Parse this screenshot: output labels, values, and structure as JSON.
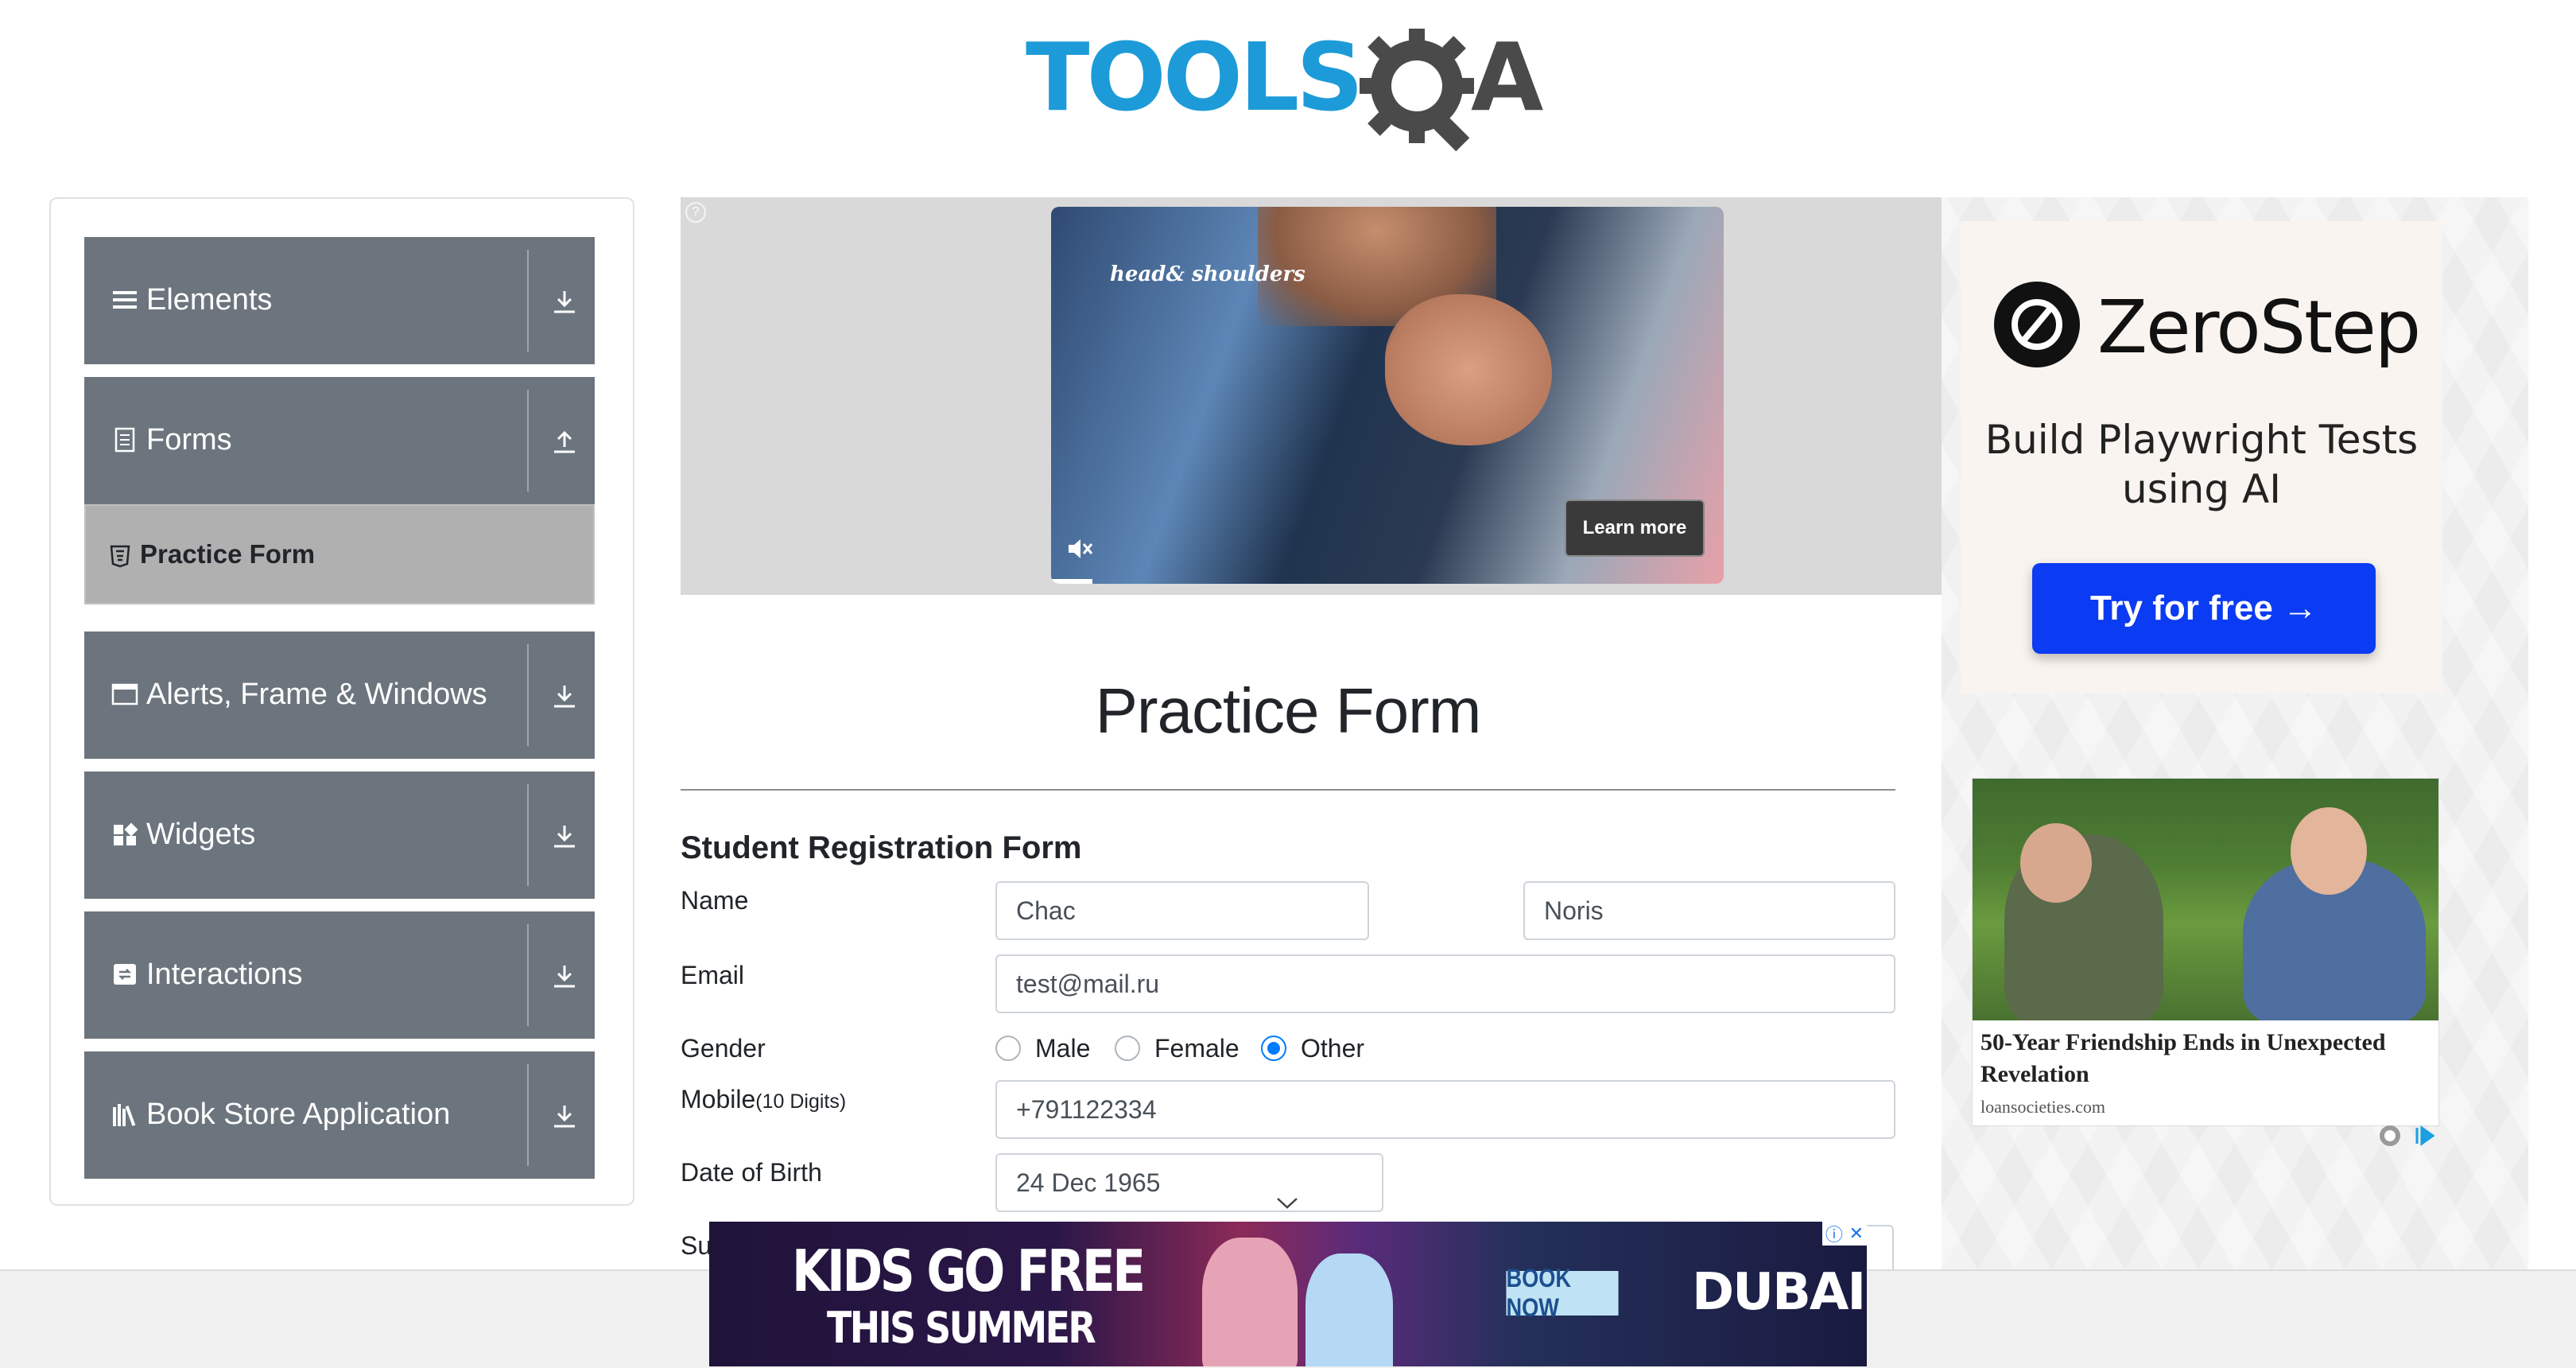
{
  "logo": {
    "tools": "TOOLS",
    "qa_letter": "A",
    "icon": "gear-magnifier-icon"
  },
  "sidebar": {
    "groups": [
      {
        "label": "Elements",
        "icon": "hamburger-icon",
        "arrow": "download-arrow-icon"
      },
      {
        "label": "Forms",
        "icon": "document-icon",
        "arrow": "upload-arrow-icon"
      },
      {
        "label": "Alerts, Frame & Windows",
        "icon": "window-icon",
        "arrow": "download-arrow-icon"
      },
      {
        "label": "Widgets",
        "icon": "widgets-icon",
        "arrow": "download-arrow-icon"
      },
      {
        "label": "Interactions",
        "icon": "interactions-icon",
        "arrow": "download-arrow-icon"
      },
      {
        "label": "Book Store Application",
        "icon": "books-icon",
        "arrow": "download-arrow-icon"
      }
    ],
    "active_item": {
      "label": "Practice Form",
      "icon": "html5-icon"
    }
  },
  "top_ad": {
    "brand": "head& shoulders",
    "learn_more": "Learn more",
    "mute_icon": "muted-speaker-icon"
  },
  "page": {
    "title": "Practice Form"
  },
  "form": {
    "title": "Student Registration Form",
    "name_label": "Name",
    "first_name": "Chac",
    "last_name": "Noris",
    "email_label": "Email",
    "email": "test@mail.ru",
    "gender_label": "Gender",
    "genders": [
      "Male",
      "Female",
      "Other"
    ],
    "gender_selected": "Other",
    "mobile_label": "Mobile",
    "mobile_hint": "(10 Digits)",
    "mobile": "+791122334",
    "dob_label": "Date of Birth",
    "dob": "24 Dec 1965",
    "subjects_label_partial": "Su"
  },
  "right_ads": {
    "zerostep": {
      "name": "ZeroStep",
      "tagline": "Build Playwright Tests using AI",
      "button": "Try for free →"
    },
    "native": {
      "headline": "50-Year Friendship Ends in Unexpected Revelation",
      "source": "loansocieties.com"
    }
  },
  "bottom_banner": {
    "line1": "KIDS GO FREE",
    "line2": "THIS SUMMER",
    "cta": "BOOK NOW",
    "brand": "DUBAI",
    "close": "✕"
  },
  "colors": {
    "sidebar": "#6c757d",
    "active": "#b0b0b0",
    "radio": "#007bff",
    "logo_blue": "#1d9bd8",
    "cta_blue": "#0b3bf2"
  }
}
